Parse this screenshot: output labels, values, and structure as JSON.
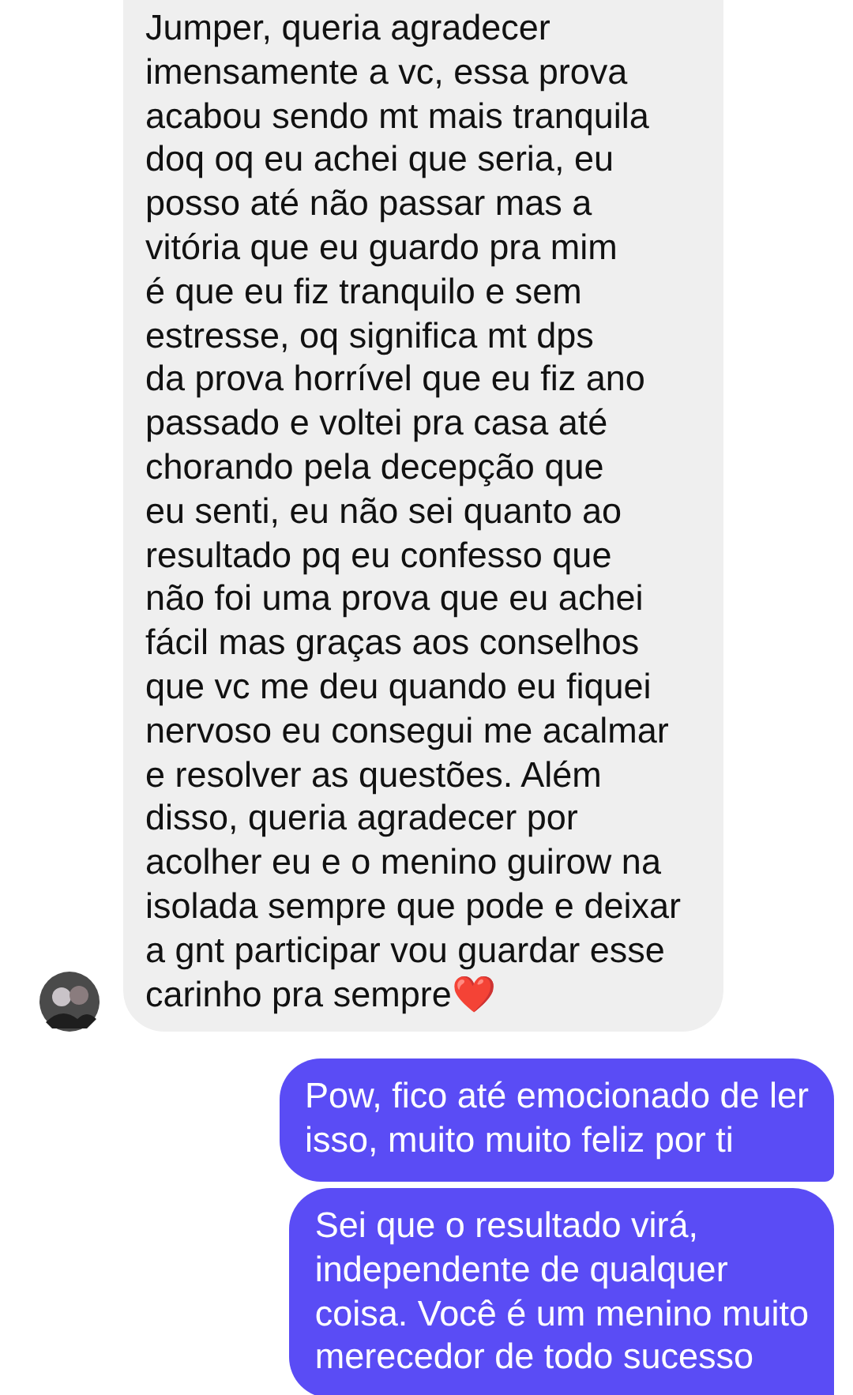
{
  "messages": [
    {
      "kind": "received",
      "avatar": true,
      "lines": [
        "Jumper, queria agradecer",
        "imensamente a vc, essa prova",
        "acabou sendo mt mais tranquila",
        "doq oq eu achei que seria, eu",
        "posso até não passar mas a",
        "vitória que eu guardo pra mim",
        "é que eu fiz tranquilo e sem",
        "estresse, oq significa mt dps",
        "da prova horrível que eu fiz ano",
        "passado e voltei pra casa até",
        "chorando pela decepção que",
        "eu senti, eu não sei quanto ao",
        "resultado pq eu confesso que",
        "não foi uma prova que eu achei",
        "fácil mas graças aos conselhos",
        "que vc me deu quando eu fiquei",
        "nervoso eu consegui me acalmar",
        "e resolver as questões. Além",
        "disso, queria agradecer por",
        "acolher eu e o menino guirow na",
        "isolada sempre que pode e deixar",
        "a gnt participar vou guardar esse",
        "carinho pra sempre❤️"
      ]
    },
    {
      "kind": "sent",
      "avatar": false,
      "lines": [
        "Pow, fico até emocionado de ler",
        "isso, muito muito feliz por ti"
      ]
    },
    {
      "kind": "sent",
      "avatar": false,
      "lines": [
        "Sei que o resultado virá,",
        "independente de qualquer",
        "coisa. Você é um menino muito",
        "merecedor de todo sucesso"
      ]
    }
  ]
}
